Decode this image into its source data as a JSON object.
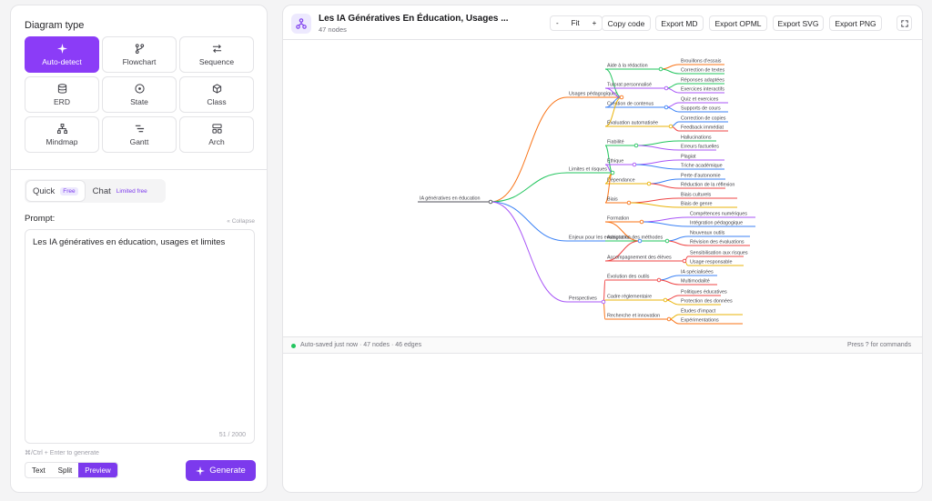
{
  "left_panel": {
    "diagram_type_label": "Diagram type",
    "diagram_types": [
      {
        "label": "Auto-detect",
        "icon": "sparkle-icon",
        "active": true
      },
      {
        "label": "Flowchart",
        "icon": "branch-icon"
      },
      {
        "label": "Sequence",
        "icon": "swap-arrows-icon"
      },
      {
        "label": "ERD",
        "icon": "database-icon"
      },
      {
        "label": "State",
        "icon": "target-icon"
      },
      {
        "label": "Class",
        "icon": "cube-icon"
      },
      {
        "label": "Mindmap",
        "icon": "hierarchy-icon"
      },
      {
        "label": "Gantt",
        "icon": "gantt-bars-icon"
      },
      {
        "label": "Arch",
        "icon": "layout-blocks-icon"
      }
    ],
    "mode_tabs": [
      {
        "label": "Quick",
        "badge": "Free",
        "active": true
      },
      {
        "label": "Chat",
        "badge": "Limited free"
      }
    ],
    "prompt_label": "Prompt:",
    "collapse_label": "« Collapse",
    "prompt_value": "Les IA génératives en éducation, usages et limites",
    "char_count": "51 / 2000",
    "shortcut_hint": "⌘/Ctrl + Enter to generate",
    "view_modes": [
      "Text",
      "Split",
      "Preview"
    ],
    "active_view_mode": "Preview",
    "generate_label": "Generate"
  },
  "header": {
    "title": "Les IA Génératives En Éducation, Usages ...",
    "subtitle": "47 nodes",
    "zoom_out": "-",
    "zoom_fit": "Fit",
    "zoom_in": "+",
    "buttons": [
      "Copy code",
      "Export MD",
      "Export OPML",
      "Export SVG",
      "Export PNG"
    ],
    "fullscreen_icon": "expand-icon"
  },
  "mindmap": {
    "root": "IA génératives en éducation",
    "branches": [
      {
        "label": "Usages pédagogiques",
        "color": "#f97316",
        "children": [
          {
            "label": "Aide à la rédaction",
            "color": "#22c55e",
            "leaves": [
              "Brouillons d'essais",
              "Correction de textes"
            ]
          },
          {
            "label": "Tutorat personnalisé",
            "color": "#a855f7",
            "leaves": [
              "Réponses adaptées",
              "Exercices interactifs"
            ]
          },
          {
            "label": "Création de contenus",
            "color": "#3b82f6",
            "leaves": [
              "Quiz et exercices",
              "Supports de cours"
            ]
          },
          {
            "label": "Évaluation automatisée",
            "color": "#eab308",
            "leaves": [
              "Correction de copies",
              "Feedback immédiat"
            ]
          }
        ]
      },
      {
        "label": "Limites et risques",
        "color": "#22c55e",
        "children": [
          {
            "label": "Fiabilité",
            "color": "#22c55e",
            "leaves": [
              "Hallucinations",
              "Erreurs factuelles"
            ]
          },
          {
            "label": "Éthique",
            "color": "#a855f7",
            "leaves": [
              "Plagiat",
              "Triche académique"
            ]
          },
          {
            "label": "Dépendance",
            "color": "#eab308",
            "leaves": [
              "Perte d'autonomie",
              "Réduction de la réflexion"
            ]
          },
          {
            "label": "Biais",
            "color": "#f97316",
            "leaves": [
              "Biais culturels",
              "Biais de genre"
            ]
          }
        ]
      },
      {
        "label": "Enjeux pour les enseignants",
        "color": "#3b82f6",
        "children": [
          {
            "label": "Formation",
            "color": "#f97316",
            "leaves": [
              "Compétences numériques",
              "Intégration pédagogique"
            ]
          },
          {
            "label": "Adaptation des méthodes",
            "color": "#22c55e",
            "leaves": [
              "Nouveaux outils",
              "Révision des évaluations"
            ]
          },
          {
            "label": "Accompagnement des élèves",
            "color": "#ef4444",
            "leaves": [
              "Sensibilisation aux risques",
              "Usage responsable"
            ]
          }
        ]
      },
      {
        "label": "Perspectives",
        "color": "#a855f7",
        "children": [
          {
            "label": "Évolution des outils",
            "color": "#ef4444",
            "leaves": [
              "IA spécialisées",
              "Multimodalité"
            ]
          },
          {
            "label": "Cadre réglementaire",
            "color": "#eab308",
            "leaves": [
              "Politiques éducatives",
              "Protection des données"
            ]
          },
          {
            "label": "Recherche et innovation",
            "color": "#f97316",
            "leaves": [
              "Études d'impact",
              "Expérimentations"
            ]
          }
        ]
      }
    ]
  },
  "status": {
    "text": "Auto-saved just now · 47 nodes · 46 edges",
    "hint": "Press ? for commands"
  }
}
